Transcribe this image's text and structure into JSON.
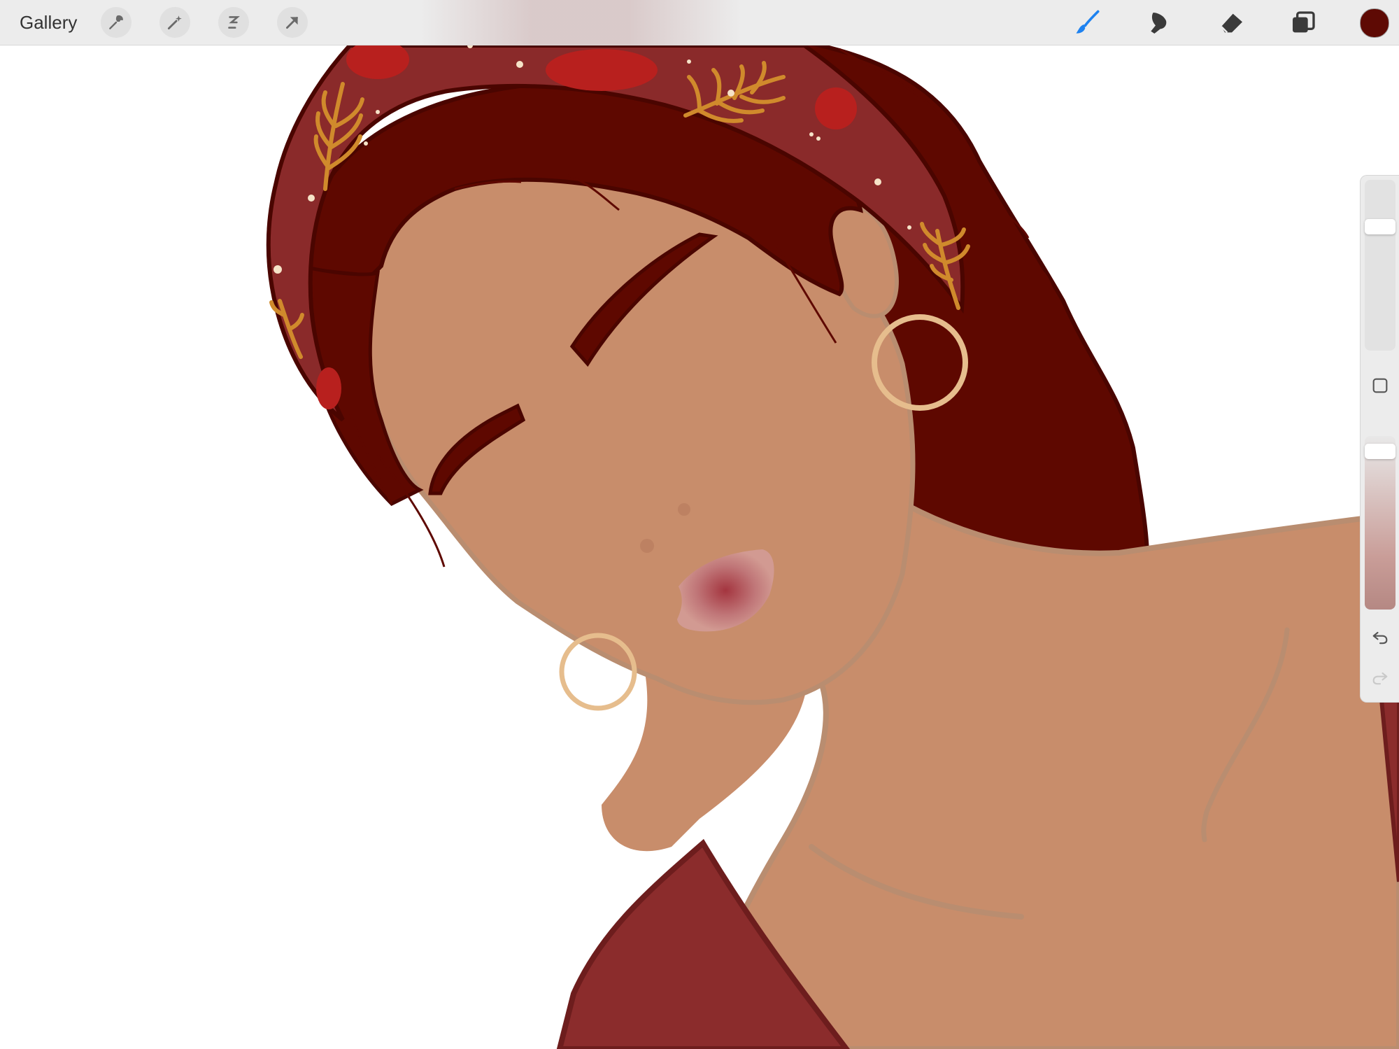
{
  "toolbar": {
    "gallery_label": "Gallery",
    "left_tools": [
      "wrench-icon",
      "magic-wand-icon",
      "selection-icon",
      "move-arrow-icon"
    ],
    "right_tools": [
      "brush-icon",
      "smudge-icon",
      "eraser-icon",
      "layers-icon"
    ],
    "active_tool": "brush-icon",
    "active_color": "#5e0a04",
    "accent_color": "#1e82f0"
  },
  "sidebar": {
    "brush_size": 0.75,
    "opacity": 0.05,
    "buttons": [
      "modify-square-icon",
      "undo-icon",
      "redo-icon"
    ]
  },
  "artwork": {
    "palette": {
      "skin": "#c88d6b",
      "skin_line": "#b98d70",
      "hair": "#5e0800",
      "scarf": "#8a2a2a",
      "scarf_spots": "#b8201e",
      "leaf": "#d08a2c",
      "earring": "#e6bd8d",
      "lips": "#b2585a",
      "shirt": "#8b2c2c"
    }
  }
}
